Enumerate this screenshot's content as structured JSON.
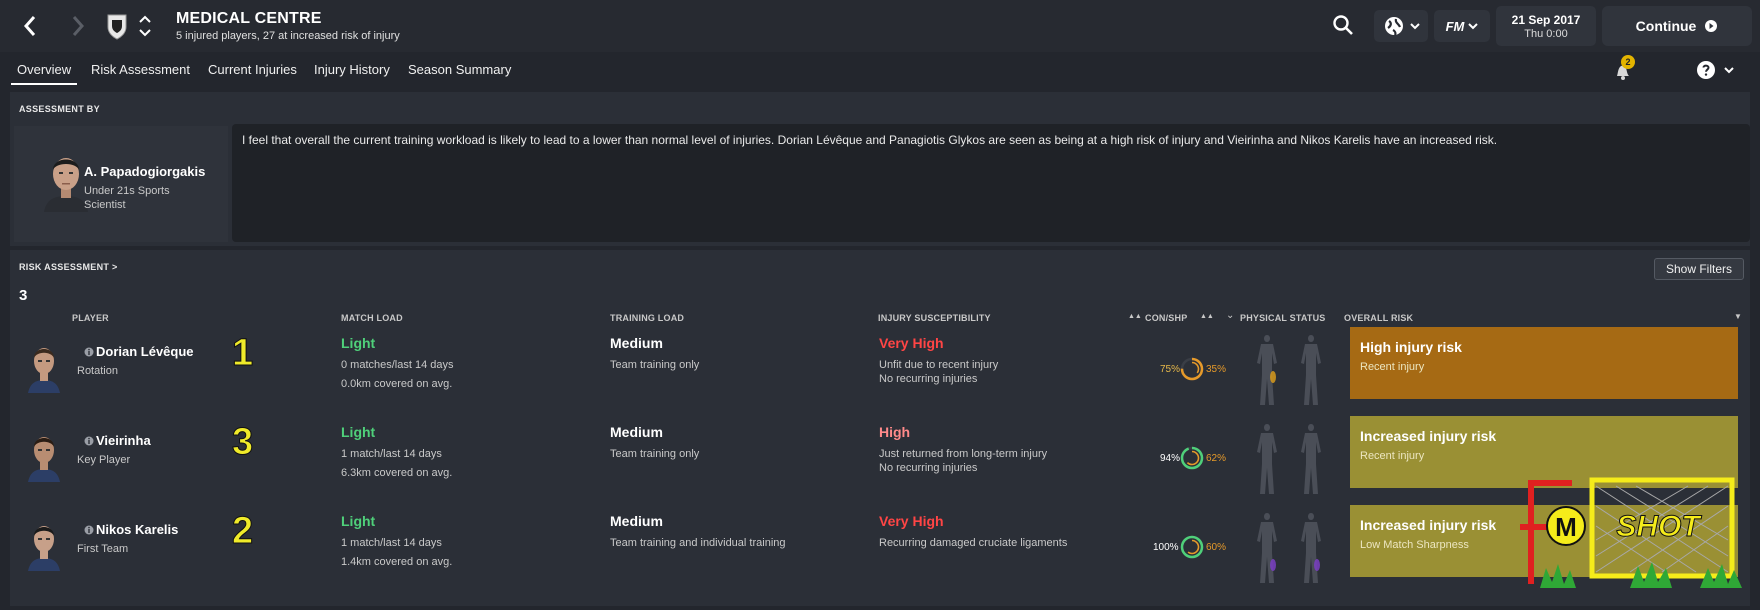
{
  "header": {
    "title": "MEDICAL CENTRE",
    "subtitle": "5 injured players, 27 at increased risk of injury",
    "date": "21 Sep 2017",
    "time": "Thu 0:00",
    "continue_label": "Continue",
    "fm_label": "FM"
  },
  "tabs": [
    {
      "label": "Overview",
      "active": true
    },
    {
      "label": "Risk Assessment"
    },
    {
      "label": "Current Injuries"
    },
    {
      "label": "Injury History"
    },
    {
      "label": "Season Summary"
    }
  ],
  "notifications": {
    "count": "2"
  },
  "assessment": {
    "section_label": "ASSESSMENT BY",
    "name": "A. Papadogiorgakis",
    "role": "Under 21s Sports Scientist",
    "text": "I feel that overall the current training workload is likely to lead to a lower than normal level of injuries. Dorian Lévêque and Panagiotis Glykos are seen as being at a high risk of injury and Vieirinha and Nikos Karelis have an increased risk."
  },
  "risk": {
    "section_label": "RISK ASSESSMENT >",
    "show_filters": "Show Filters",
    "count": "3",
    "columns": {
      "player": "PLAYER",
      "match_load": "MATCH LOAD",
      "training_load": "TRAINING LOAD",
      "injury_susceptibility": "INJURY SUSCEPTIBILITY",
      "con_shp": "CON/SHP",
      "physical_status": "PHYSICAL STATUS",
      "overall_risk": "OVERALL RISK"
    },
    "rows": [
      {
        "name": "Dorian Lévêque",
        "role": "Rotation",
        "number": "1",
        "match_load": "Light",
        "match_detail1": "0 matches/last 14 days",
        "match_detail2": "0.0km covered on avg.",
        "training_load": "Medium",
        "training_detail": "Team training only",
        "susceptibility": "Very High",
        "susc_detail1": "Unfit due to recent injury",
        "susc_detail2": "No recurring injuries",
        "condition": "75%",
        "sharpness": "35%",
        "condition_value": 75,
        "sharpness_value": 35,
        "risk_title": "High injury risk",
        "risk_detail": "Recent injury",
        "risk_color": "#a66a14"
      },
      {
        "name": "Vieirinha",
        "role": "Key Player",
        "number": "3",
        "match_load": "Light",
        "match_detail1": "1 match/last 14 days",
        "match_detail2": "6.3km covered on avg.",
        "training_load": "Medium",
        "training_detail": "Team training only",
        "susceptibility": "High",
        "susc_detail1": "Just returned from long-term injury",
        "susc_detail2": "No recurring injuries",
        "condition": "94%",
        "sharpness": "62%",
        "condition_value": 94,
        "sharpness_value": 62,
        "risk_title": "Increased injury risk",
        "risk_detail": "Recent injury",
        "risk_color": "#9a9034"
      },
      {
        "name": "Nikos Karelis",
        "role": "First Team",
        "number": "2",
        "match_load": "Light",
        "match_detail1": "1 match/last 14 days",
        "match_detail2": "1.4km covered on avg.",
        "training_load": "Medium",
        "training_detail": "Team training and individual training",
        "susceptibility": "Very High",
        "susc_detail1": "Recurring damaged cruciate ligaments",
        "susc_detail2": "",
        "condition": "100%",
        "sharpness": "60%",
        "condition_value": 100,
        "sharpness_value": 60,
        "risk_title": "Increased injury risk",
        "risk_detail": "Low Match Sharpness",
        "risk_color": "#9a9034"
      }
    ]
  },
  "watermark": {
    "letter_f": "F",
    "letter_m": "M",
    "word": "SHOT"
  },
  "icons": {
    "back": "chevron-left-icon",
    "forward": "chevron-right-icon",
    "search": "search-icon",
    "world": "globe-icon",
    "help": "help-icon"
  }
}
